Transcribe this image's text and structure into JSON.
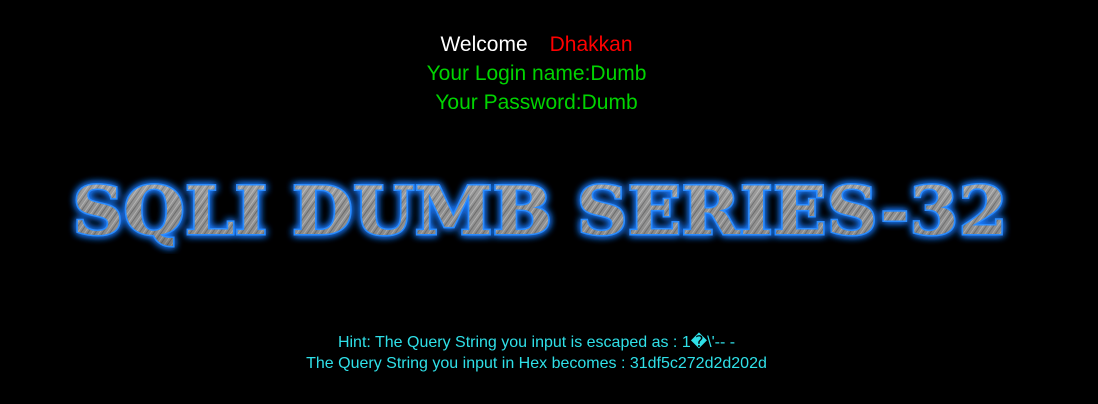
{
  "welcome": {
    "greeting": "Welcome",
    "user": "Dhakkan",
    "login_line": "Your Login name:Dumb",
    "password_line": "Your Password:Dumb"
  },
  "banner": {
    "title": "SQLI DUMB SERIES-32"
  },
  "hint": {
    "escaped_line": "Hint: The Query String you input is escaped as : 1�\\'-- -",
    "hex_line": "The Query String you input in Hex becomes : 31df5c272d2d202d"
  },
  "colors": {
    "background": "#000000",
    "greeting": "#ffffff",
    "user": "#ff0000",
    "credentials": "#00d400",
    "hint": "#2fe0e8",
    "banner_glow": "#1e7bff"
  }
}
